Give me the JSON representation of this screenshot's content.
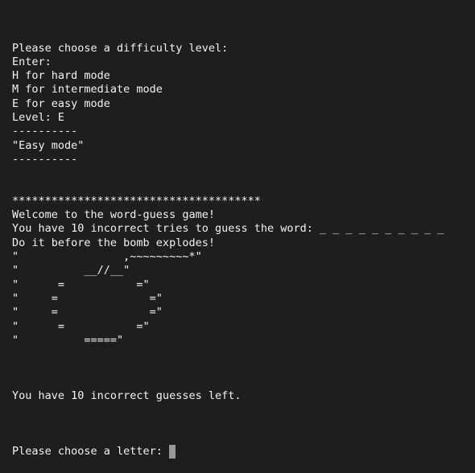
{
  "terminal": {
    "colors": {
      "background": "#1e1e1e",
      "text": "#f2f2f2",
      "cursor": "#9a9a9a"
    },
    "lines": [
      "Please choose a difficulty level:",
      "Enter:",
      "H for hard mode",
      "M for intermediate mode",
      "E for easy mode",
      "Level: E",
      "----------",
      "\"Easy mode\"",
      "----------",
      "",
      "",
      "**************************************",
      "Welcome to the word-guess game!",
      "You have 10 incorrect tries to guess the word: _ _ _ _ _ _ _ _ _ _",
      "Do it before the bomb explodes!",
      "\"                ,~~~~~~~~~*\"",
      "\"          __//__\"",
      "\"      =           =\"",
      "\"     =              =\"",
      "\"     =              =\"",
      "\"      =           =\"",
      "\"          =====\"",
      "",
      "",
      "",
      "You have 10 incorrect guesses left.",
      ""
    ],
    "prompt": "Please choose a letter: "
  }
}
